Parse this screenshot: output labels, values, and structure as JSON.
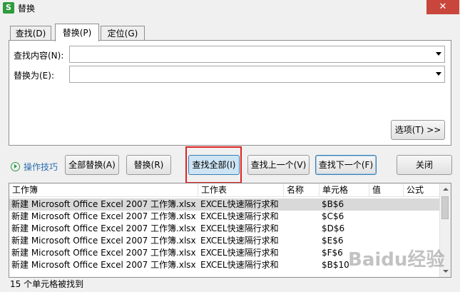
{
  "window": {
    "title": "替换",
    "close_glyph": "✕",
    "app_icon": "S"
  },
  "tabs": [
    {
      "label": "查找(D)",
      "active": false
    },
    {
      "label": "替换(P)",
      "active": true
    },
    {
      "label": "定位(G)",
      "active": false
    }
  ],
  "find": {
    "label": "查找内容(N):",
    "value": ""
  },
  "replace": {
    "label": "替换为(E):",
    "value": ""
  },
  "options_button": "选项(T) >>",
  "tips_link": "操作技巧",
  "buttons": {
    "replace_all": "全部替换(A)",
    "replace": "替换(R)",
    "find_all": "查找全部(I)",
    "find_prev": "查找上一个(V)",
    "find_next": "查找下一个(F)",
    "close": "关闭"
  },
  "results": {
    "columns": [
      "工作簿",
      "工作表",
      "名称",
      "单元格",
      "值",
      "公式"
    ],
    "rows": [
      {
        "workbook": "新建 Microsoft Office Excel 2007 工作簿.xlsx",
        "sheet": "EXCEL快速隔行求和",
        "cell": "$B$6"
      },
      {
        "workbook": "新建 Microsoft Office Excel 2007 工作簿.xlsx",
        "sheet": "EXCEL快速隔行求和",
        "cell": "$C$6"
      },
      {
        "workbook": "新建 Microsoft Office Excel 2007 工作簿.xlsx",
        "sheet": "EXCEL快速隔行求和",
        "cell": "$D$6"
      },
      {
        "workbook": "新建 Microsoft Office Excel 2007 工作簿.xlsx",
        "sheet": "EXCEL快速隔行求和",
        "cell": "$E$6"
      },
      {
        "workbook": "新建 Microsoft Office Excel 2007 工作簿.xlsx",
        "sheet": "EXCEL快速隔行求和",
        "cell": "$F$6"
      },
      {
        "workbook": "新建 Microsoft Office Excel 2007 工作簿.xlsx",
        "sheet": "EXCEL快速隔行求和",
        "cell": "$B$10"
      }
    ]
  },
  "status": "15 个单元格被找到",
  "watermark": "Baidu经验"
}
